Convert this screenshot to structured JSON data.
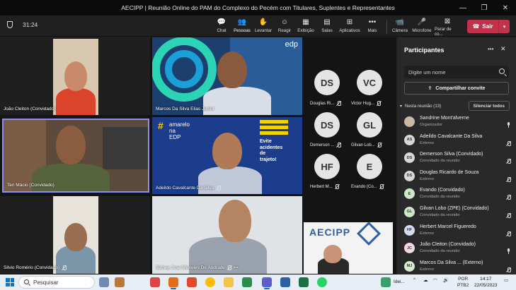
{
  "window": {
    "title": "AECIPP | Reunião Online do PAM do Complexo do Pecém com Titulares, Suplentes e Representantes",
    "controls": [
      "—",
      "❐",
      "✕"
    ]
  },
  "toolbar": {
    "timer": "31:24",
    "buttons": [
      {
        "label": "Chat",
        "icon": "chat-icon",
        "glyph": "💬"
      },
      {
        "label": "Pessoas",
        "icon": "people-icon",
        "glyph": "👥"
      },
      {
        "label": "Levantar",
        "icon": "raise-hand-icon",
        "glyph": "✋"
      },
      {
        "label": "Reagir",
        "icon": "react-icon",
        "glyph": "☺"
      },
      {
        "label": "Exibição",
        "icon": "view-icon",
        "glyph": "▦"
      },
      {
        "label": "Salas",
        "icon": "rooms-icon",
        "glyph": "▤"
      },
      {
        "label": "Aplicativos",
        "icon": "apps-icon",
        "glyph": "⊞"
      },
      {
        "label": "Mais",
        "icon": "more-icon",
        "glyph": "•••"
      },
      {
        "label": "Câmera",
        "icon": "camera-icon",
        "glyph": "📹"
      },
      {
        "label": "Microfone",
        "icon": "microphone-icon",
        "glyph": "🎤"
      },
      {
        "label": "Parar de co...",
        "icon": "stop-share-icon",
        "glyph": "⊠"
      }
    ],
    "leave_label": "Sair",
    "accent": "#c4314b"
  },
  "tiles": {
    "joao": "João Cleiton (Convidado)",
    "marcos": "Marcos Da Silva Elias Junior",
    "edp_logo": "edp",
    "ten": "Ten Mácio (Convidado)",
    "adeildo": "Adeildo Cavalcante Da Silva",
    "amarelo_line1": "amarelo",
    "amarelo_line2": "na",
    "amarelo_line3": "EDP",
    "evite": [
      "Evite",
      "acidentes",
      "de",
      "trajeto!"
    ],
    "silvio": "Silvio Romério (Convidado)",
    "sidney": "Sidney Jose Meireles De Andrade",
    "sidney_more": "•••",
    "aecipp_logo": "AECIPP"
  },
  "avatar_grid": [
    {
      "initials": "DS",
      "name": "Douglas Ri..."
    },
    {
      "initials": "VC",
      "name": "Victor Hug..."
    },
    {
      "initials": "DS",
      "name": "Demerson ..."
    },
    {
      "initials": "GL",
      "name": "Gilvan Lob..."
    },
    {
      "initials": "HF",
      "name": "Herbert M..."
    },
    {
      "initials": "E",
      "name": "Evando (Co..."
    }
  ],
  "panel": {
    "title": "Participantes",
    "more": "•••",
    "close": "✕",
    "search_placeholder": "Digite um nome",
    "share_invite": "Compartilhar convite",
    "share_icon": "⇪",
    "section": "Nesta reunião (13)",
    "mute_all": "Silenciar todos",
    "participants": [
      {
        "initials": "",
        "name": "Sandrine Mont'alverne",
        "role": "Organizador",
        "mic": "on",
        "color": "#c9b8a6"
      },
      {
        "initials": "AS",
        "name": "Adeildo Cavalcante Da Silva",
        "role": "Externo",
        "mic": "off",
        "color": "#d8d8d8"
      },
      {
        "initials": "DS",
        "name": "Demerson Silva (Convidado)",
        "role": "Convidado da reunião",
        "mic": "off",
        "color": "#d8d8d8"
      },
      {
        "initials": "DS",
        "name": "Douglas Ricardo de Souza",
        "role": "Externo",
        "mic": "off",
        "color": "#d8d8d8"
      },
      {
        "initials": "E",
        "name": "Evando (Convidado)",
        "role": "Convidado da reunião",
        "mic": "off",
        "color": "#cde6c8"
      },
      {
        "initials": "GL",
        "name": "Gilvan Lobo (ZPE) (Convidado)",
        "role": "Convidado da reunião",
        "mic": "off",
        "color": "#cde6c8"
      },
      {
        "initials": "HF",
        "name": "Herbert Marcel Figueredo",
        "role": "Externo",
        "mic": "off",
        "color": "#d6dcf0"
      },
      {
        "initials": "JC",
        "name": "João Cleiton (Convidado)",
        "role": "Convidado da reunião",
        "mic": "on",
        "color": "#f0d6e6"
      },
      {
        "initials": "MJ",
        "name": "Marcos Da Silva ... (Externo)",
        "role": "Externo",
        "mic": "off",
        "color": "#d8ead0"
      }
    ]
  },
  "taskbar": {
    "search_placeholder": "Pesquisar",
    "idei": "Idei...",
    "lang1": "POR",
    "lang2": "PTB2",
    "time": "14:17",
    "date": "22/05/2023"
  }
}
